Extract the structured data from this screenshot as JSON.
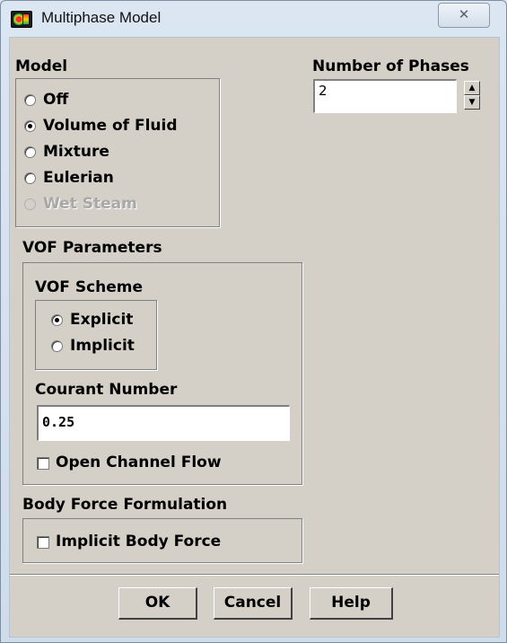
{
  "window": {
    "title": "Multiphase Model",
    "close_glyph": "✕"
  },
  "model": {
    "label": "Model",
    "options": [
      {
        "label": "Off",
        "selected": false,
        "enabled": true
      },
      {
        "label": "Volume of Fluid",
        "selected": true,
        "enabled": true
      },
      {
        "label": "Mixture",
        "selected": false,
        "enabled": true
      },
      {
        "label": "Eulerian",
        "selected": false,
        "enabled": true
      },
      {
        "label": "Wet Steam",
        "selected": false,
        "enabled": false
      }
    ]
  },
  "phases": {
    "label": "Number of Phases",
    "value": "2"
  },
  "vof": {
    "label": "VOF Parameters",
    "scheme_label": "VOF Scheme",
    "schemes": [
      {
        "label": "Explicit",
        "selected": true
      },
      {
        "label": "Implicit",
        "selected": false
      }
    ],
    "courant_label": "Courant Number",
    "courant_value": "0.25",
    "open_channel_label": "Open Channel Flow",
    "open_channel_checked": false
  },
  "body_force": {
    "label": "Body Force Formulation",
    "implicit_label": "Implicit Body Force",
    "implicit_checked": false
  },
  "buttons": {
    "ok": "OK",
    "cancel": "Cancel",
    "help": "Help"
  }
}
